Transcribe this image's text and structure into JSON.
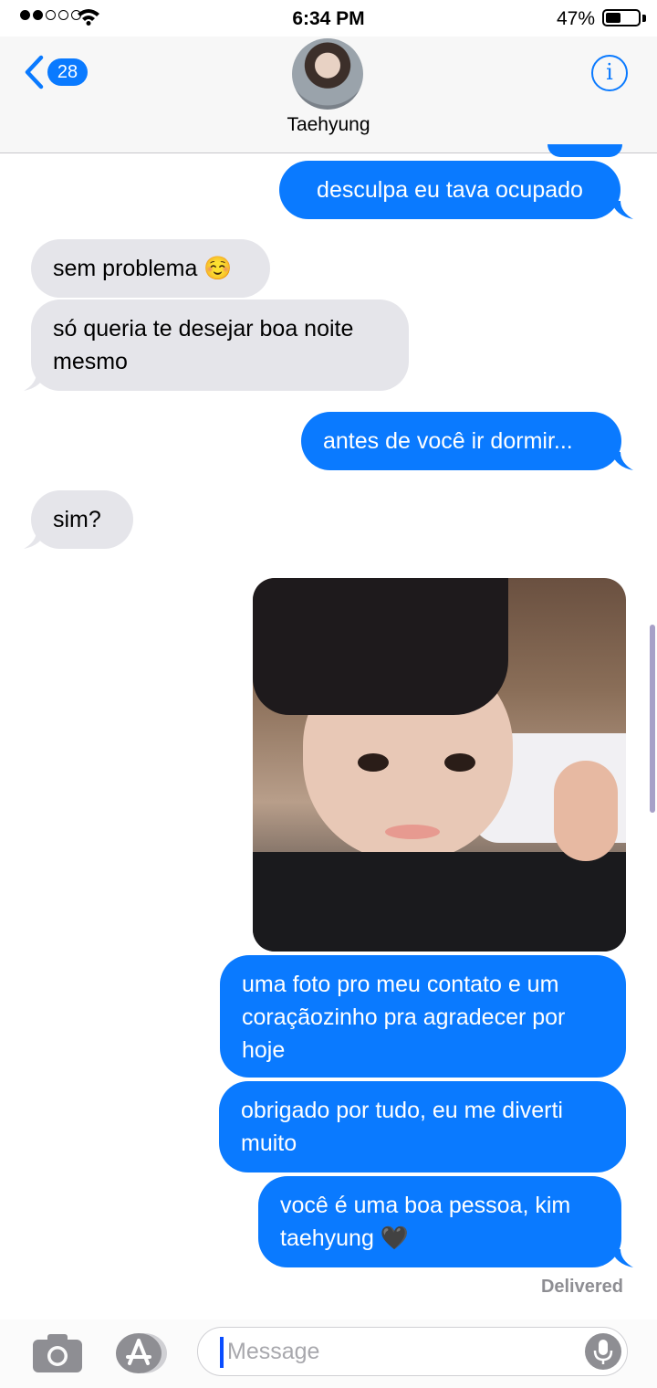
{
  "status_bar": {
    "time": "6:34 PM",
    "battery": "47%",
    "battery_level": 0.47,
    "signal_bars": 2,
    "signal_total": 5
  },
  "header": {
    "back_count": "28",
    "contact_name": "Taehyung",
    "info_symbol": "i"
  },
  "colors": {
    "outgoing_bubble": "#0a7aff",
    "incoming_bubble": "#e5e5ea",
    "accent": "#0a7aff"
  },
  "messages": [
    {
      "dir": "out",
      "text": "desculpa eu tava ocupado"
    },
    {
      "dir": "in",
      "text": "sem problema ☺️"
    },
    {
      "dir": "in",
      "text": "só queria te desejar boa noite mesmo"
    },
    {
      "dir": "out",
      "text": "antes de você ir dormir..."
    },
    {
      "dir": "in",
      "text": "sim?"
    },
    {
      "dir": "out",
      "text": "uma foto pro meu contato e um coraçãozinho pra agradecer por hoje"
    },
    {
      "dir": "out",
      "text": "obrigado por tudo, eu me diverti muito"
    },
    {
      "dir": "out",
      "text": "você é uma boa pessoa, kim taehyung 🖤"
    }
  ],
  "delivery_status": "Delivered",
  "input": {
    "placeholder": "Message"
  }
}
